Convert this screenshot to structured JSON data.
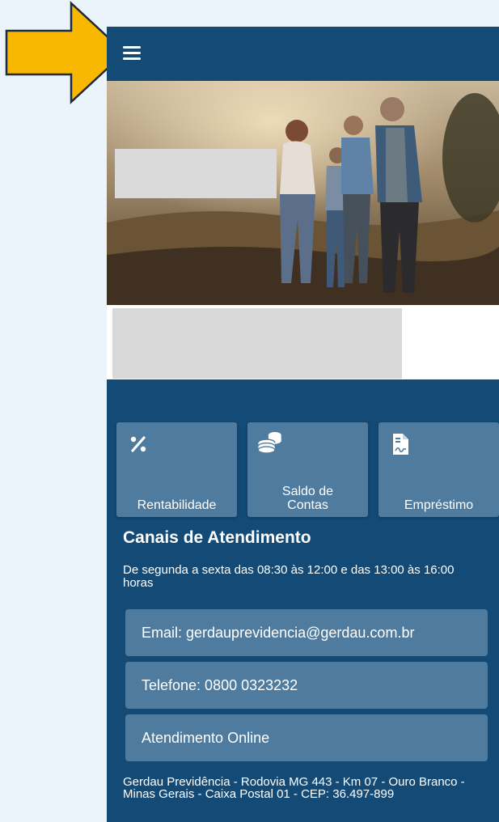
{
  "header": {
    "menu_icon": "hamburger-menu-icon"
  },
  "quick_actions": [
    {
      "label_line1": "",
      "label_line2": "Rentabilidade",
      "icon": "percent-icon"
    },
    {
      "label_line1": "Saldo de",
      "label_line2": "Contas",
      "icon": "coins-stack-icon"
    },
    {
      "label_line1": "",
      "label_line2": "Empréstimo",
      "icon": "document-signature-icon"
    }
  ],
  "channels": {
    "title": "Canais de Atendimento",
    "hours": "De segunda a sexta das 08:30 às 12:00 e das 13:00 às 16:00 horas",
    "email": "Email: gerdauprevidencia@gerdau.com.br",
    "phone": "Telefone: 0800 0323232",
    "online": "Atendimento Online"
  },
  "footer": {
    "address": "Gerdau Previdência - Rodovia MG 443 - Km 07 - Ouro Branco - Minas Gerais - Caixa Postal 01 - CEP: 36.497-899"
  },
  "colors": {
    "primary": "#134a76",
    "tile": "#4e7b9e",
    "annotation_arrow": "#f9b800"
  }
}
